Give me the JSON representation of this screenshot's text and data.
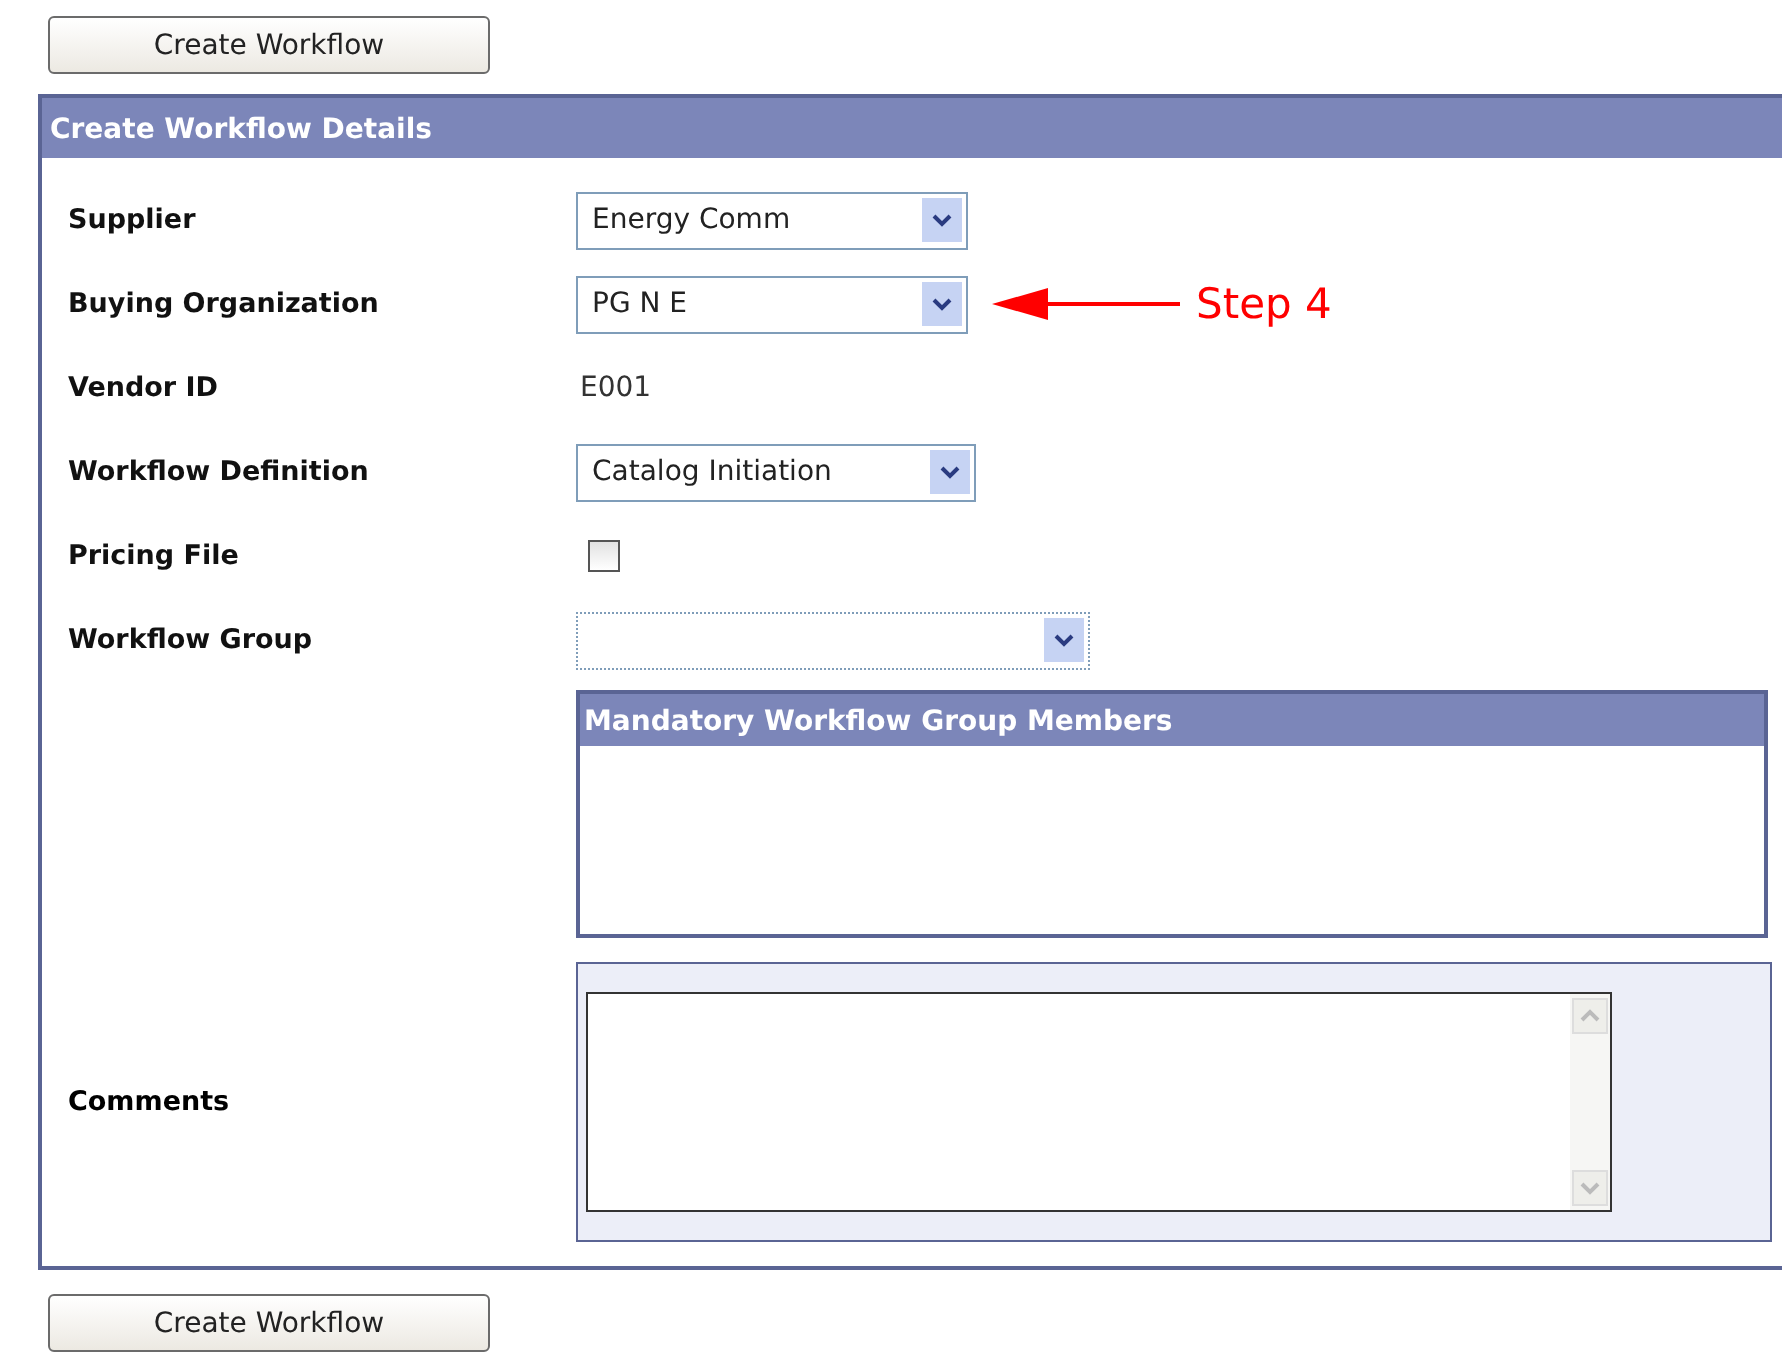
{
  "top_button": "Create Workflow",
  "panel": {
    "title": "Create Workflow Details",
    "fields": [
      {
        "kind": "select",
        "label": "Supplier",
        "value": "Energy Comm"
      },
      {
        "kind": "select",
        "label": "Buying Organization",
        "value": "PG N E",
        "annotation": "Step 4"
      },
      {
        "kind": "text",
        "label": "Vendor ID",
        "value": "E001"
      },
      {
        "kind": "select",
        "label": "Workflow Definition",
        "value": "Catalog Initiation"
      },
      {
        "kind": "checkbox",
        "label": "Pricing File",
        "checked": false
      },
      {
        "kind": "select",
        "label": "Workflow Group"
      }
    ],
    "members": {
      "title": "Mandatory Workflow Group Members"
    },
    "comments": {
      "label": "Comments"
    }
  },
  "bottom_button": "Create Workflow"
}
